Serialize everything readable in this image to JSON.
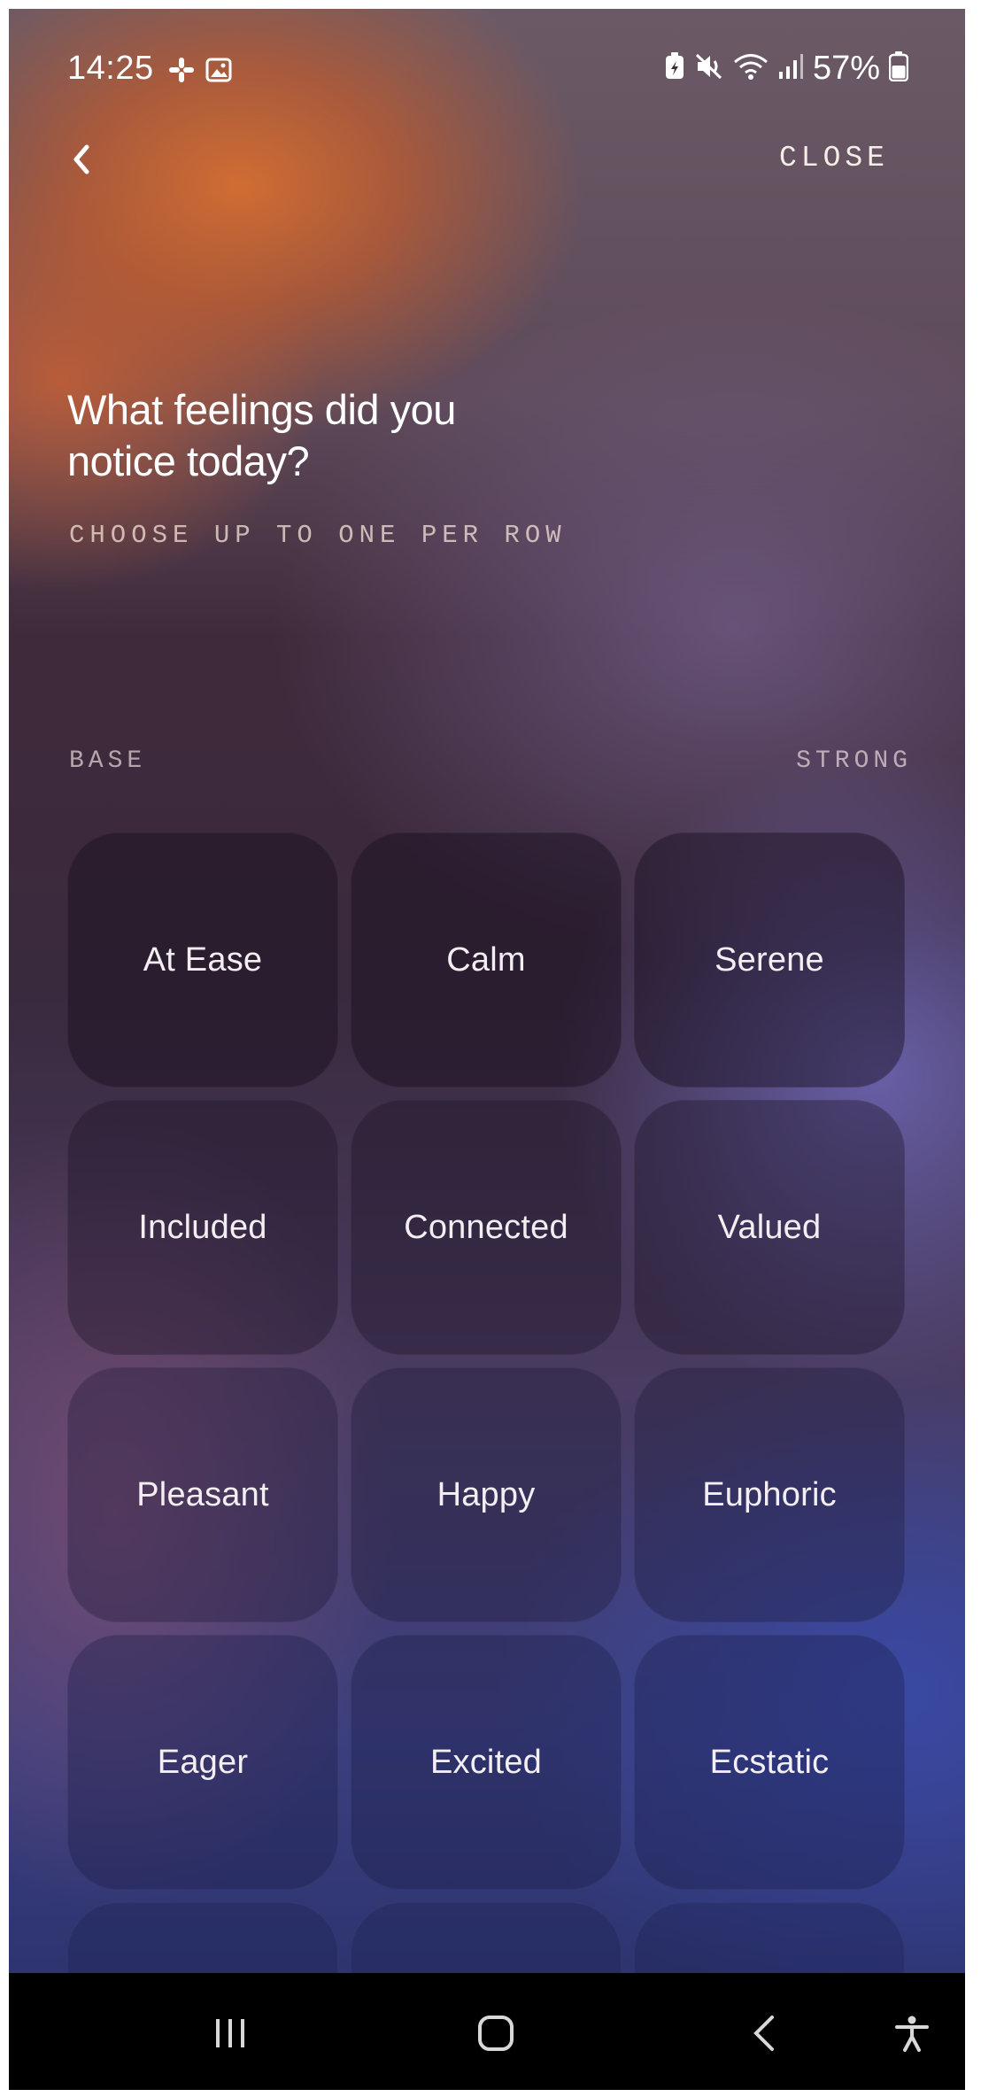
{
  "status_bar": {
    "time": "14:25",
    "battery_percent": "57%",
    "icons": [
      "slack-icon",
      "gallery-icon",
      "battery-saver-icon",
      "mute-icon",
      "wifi-icon",
      "signal-icon",
      "battery-icon"
    ]
  },
  "header": {
    "back_icon": "chevron-left-icon",
    "close_label": "CLOSE"
  },
  "prompt": {
    "title": "What feelings did you notice today?",
    "subtitle": "CHOOSE UP TO ONE PER ROW"
  },
  "scale": {
    "base_label": "BASE",
    "strong_label": "STRONG"
  },
  "feelings": {
    "rows": [
      [
        "At Ease",
        "Calm",
        "Serene"
      ],
      [
        "Included",
        "Connected",
        "Valued"
      ],
      [
        "Pleasant",
        "Happy",
        "Euphoric"
      ],
      [
        "Eager",
        "Excited",
        "Ecstatic"
      ]
    ]
  },
  "nav_bar": {
    "items": [
      "recents-icon",
      "home-icon",
      "back-icon",
      "accessibility-icon"
    ]
  },
  "colors": {
    "accent_orange": "#d66e30",
    "accent_blue": "#384aaa",
    "text": "#ffffff"
  }
}
